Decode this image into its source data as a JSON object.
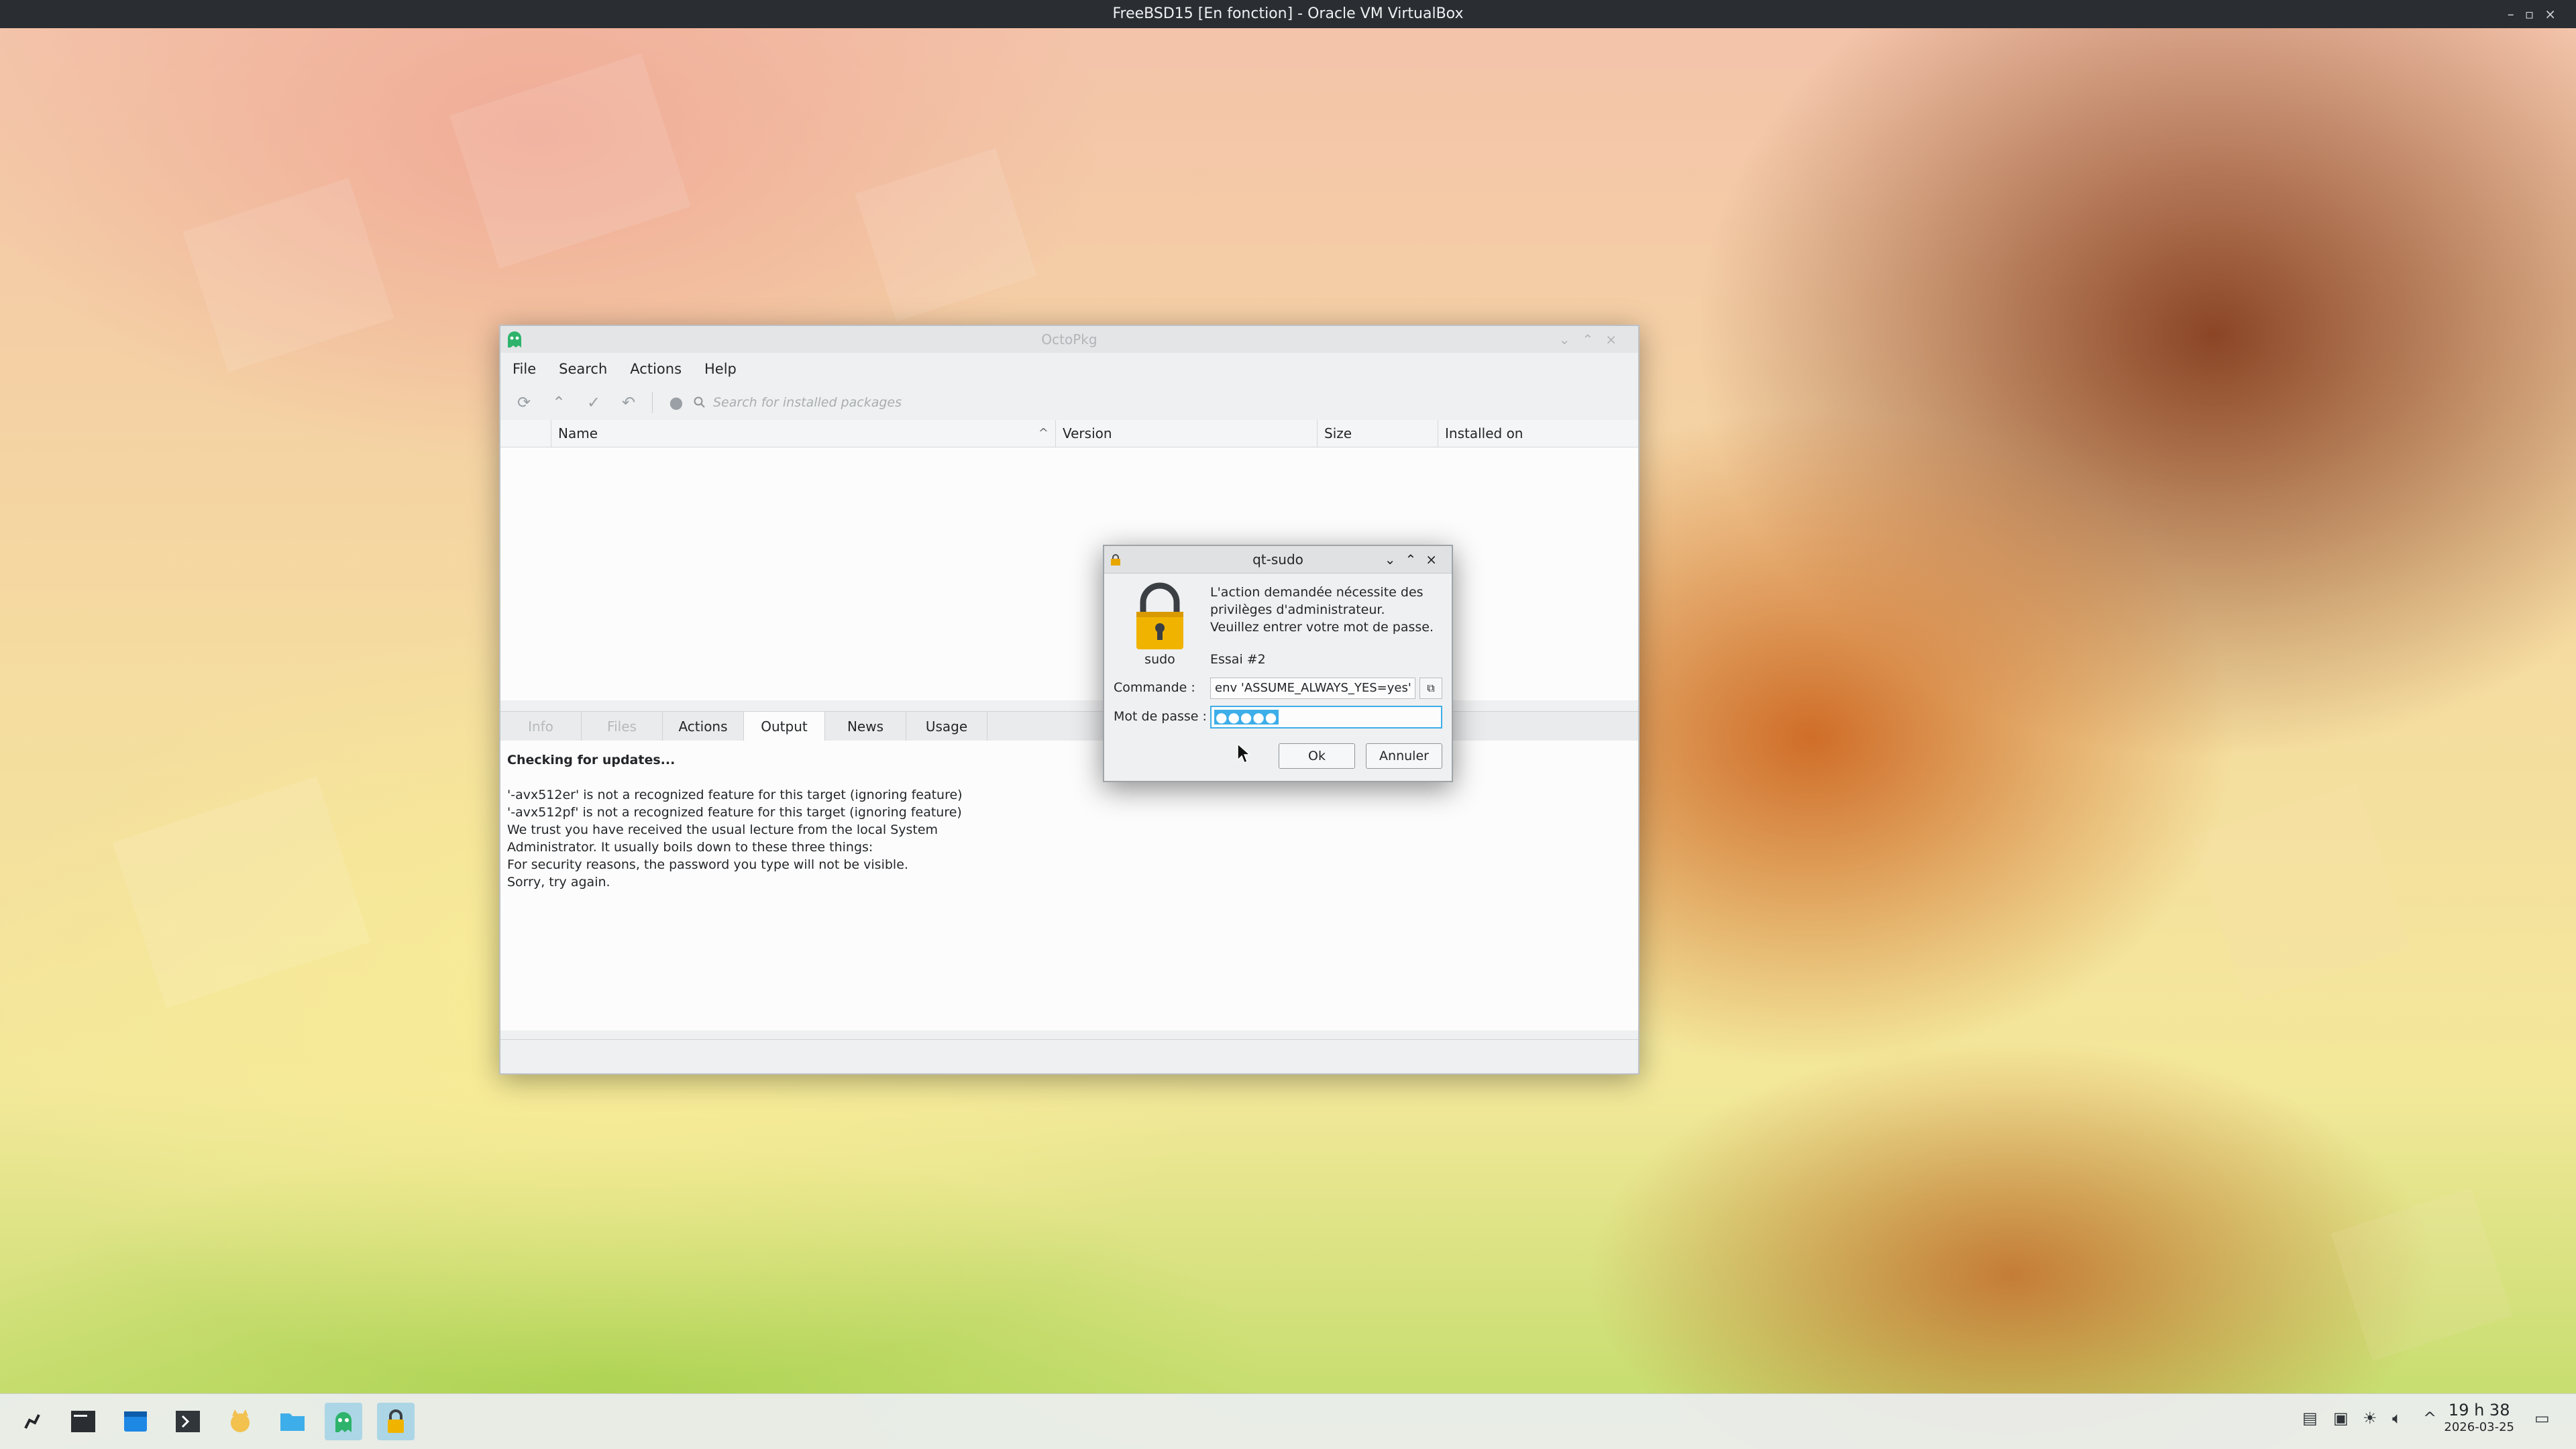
{
  "window_title": "FreeBSD15 [En fonction] - Oracle VM VirtualBox",
  "octopkg": {
    "title": "OctoPkg",
    "menu": [
      "File",
      "Search",
      "Actions",
      "Help"
    ],
    "search_placeholder": "Search for installed packages",
    "columns": {
      "name": "Name",
      "version": "Version",
      "size": "Size",
      "installed_on": "Installed on"
    },
    "tabs": [
      "Info",
      "Files",
      "Actions",
      "Output",
      "News",
      "Usage"
    ],
    "output": {
      "heading": "Checking for updates...",
      "lines": [
        "'-avx512er' is not a recognized feature for this target (ignoring feature)",
        "'-avx512pf' is not a recognized feature for this target (ignoring feature)",
        "We trust you have received the usual lecture from the local System",
        "Administrator. It usually boils down to these three things:",
        "For security reasons, the password you type will not be visible.",
        "Sorry, try again."
      ]
    }
  },
  "dialog": {
    "title": "qt-sudo",
    "message_lines": [
      "L'action demandée nécessite des",
      "privilèges d'administrateur.",
      "Veuillez entrer votre mot de passe."
    ],
    "sudo_label": "sudo",
    "attempt": "Essai #2",
    "command_label": "Commande :",
    "command_value": "env 'ASSUME_ALWAYS_YES=yes' /",
    "password_label": "Mot de passe :",
    "password_value": "●●●●●",
    "ok_label": "Ok",
    "cancel_label": "Annuler"
  },
  "taskbar": {
    "apps": [
      "start-menu",
      "terminal",
      "package-manager",
      "console",
      "file-manager-fox",
      "file-manager",
      "octopkg",
      "qt-sudo"
    ],
    "clock_time": "19 h 38",
    "clock_date": "2026-03-25"
  },
  "colors": {
    "accent": "#3daee9",
    "panel": "#2a2e32",
    "window_bg": "#eff0f1"
  }
}
